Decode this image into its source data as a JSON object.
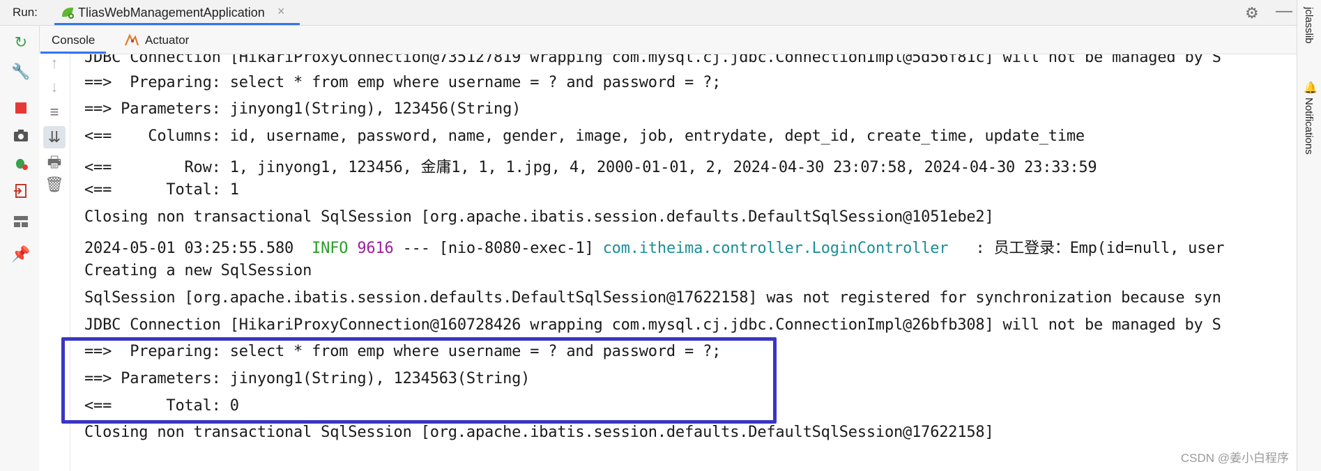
{
  "run": {
    "label": "Run:",
    "tab_title": "TliasWebManagementApplication",
    "close_symbol": "×"
  },
  "tabs": [
    {
      "label": "Console",
      "active": true
    },
    {
      "label": "Actuator",
      "active": false
    }
  ],
  "right_sidebar": {
    "items": [
      "jclasslib",
      "Notifications"
    ]
  },
  "icons": {
    "left": [
      "rerun-icon",
      "wrench-icon",
      "stop-icon",
      "camera-icon",
      "debug-icon",
      "exit-icon",
      "layout-icon",
      "pin-icon"
    ],
    "left2": [
      "up-arrow-icon",
      "down-arrow-icon",
      "soft-wrap-icon",
      "scroll-to-end-icon",
      "print-icon",
      "trash-icon"
    ]
  },
  "console": {
    "lines": [
      "JDBC Connection [HikariProxyConnection@735127819 wrapping com.mysql.cj.jdbc.ConnectionImpl@5d56f81c] will not be managed by S",
      "==>  Preparing: select * from emp where username = ? and password = ?;",
      "==> Parameters: jinyong1(String), 123456(String)",
      "<==    Columns: id, username, password, name, gender, image, job, entrydate, dept_id, create_time, update_time",
      "<==        Row: 1, jinyong1, 123456, 金庸1, 1, 1.jpg, 4, 2000-01-01, 2, 2024-04-30 23:07:58, 2024-04-30 23:33:59",
      "<==      Total: 1",
      "Closing non transactional SqlSession [org.apache.ibatis.session.defaults.DefaultSqlSession@1051ebe2]",
      "",
      "Creating a new SqlSession",
      "SqlSession [org.apache.ibatis.session.defaults.DefaultSqlSession@17622158] was not registered for synchronization because syn",
      "JDBC Connection [HikariProxyConnection@160728426 wrapping com.mysql.cj.jdbc.ConnectionImpl@26bfb308] will not be managed by S",
      "==>  Preparing: select * from emp where username = ? and password = ?;",
      "==> Parameters: jinyong1(String), 1234563(String)",
      "<==      Total: 0",
      "Closing non transactional SqlSession [org.apache.ibatis.session.defaults.DefaultSqlSession@17622158]"
    ],
    "log_line": {
      "timestamp": "2024-05-01 03:25:55.580",
      "level": "INFO",
      "pid": "9616",
      "sep": "---",
      "thread": "[nio-8080-exec-1]",
      "logger": "com.itheima.controller.LoginController",
      "message": "  : 员工登录：Emp(id=null, user"
    }
  },
  "colors": {
    "accent": "#3574f0",
    "highlight_box": "#3a35c4",
    "info": "#2a9d2a",
    "pid": "#a020a0",
    "logger": "#1a8f96",
    "stop": "#e53935",
    "green": "#38a14a"
  },
  "watermark": "CSDN @姜小白程序"
}
